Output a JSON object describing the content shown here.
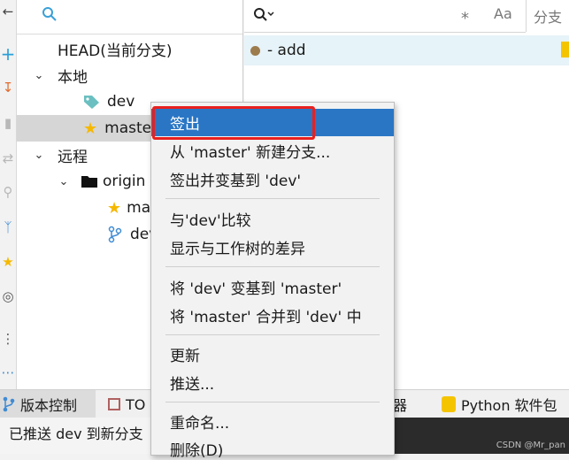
{
  "toolbar_icons": [
    "back-arrow-icon",
    "add-icon",
    "fetch-icon",
    "delete-icon",
    "compare-icon",
    "search-icon",
    "branch-graph-icon",
    "star-icon",
    "target-icon",
    "more-vertical-icon",
    "more-horizontal-icon"
  ],
  "branch_tree": {
    "head": "HEAD(当前分支)",
    "local_label": "本地",
    "local": [
      {
        "name": "dev"
      },
      {
        "name": "master"
      }
    ],
    "remote_label": "远程",
    "remote_root": "origin",
    "remote": [
      {
        "name": "master"
      },
      {
        "name": "dev"
      }
    ]
  },
  "log": {
    "search_placeholder": "",
    "case_toggle": "Aa",
    "branch_col_label": "分支",
    "rows": [
      {
        "message": "- add"
      }
    ]
  },
  "context_menu": {
    "items": [
      {
        "label": "签出",
        "highlighted": true
      },
      {
        "label": "从 'master' 新建分支..."
      },
      {
        "label": "签出并变基到 'dev'"
      },
      {
        "label": "与'dev'比较"
      },
      {
        "label": "显示与工作树的差异"
      },
      {
        "label": "将 'dev' 变基到 'master'"
      },
      {
        "label": "将 'master' 合并到 'dev' 中"
      },
      {
        "label": "更新"
      },
      {
        "label": "推送..."
      },
      {
        "label": "重命名..."
      },
      {
        "label": "删除(D)"
      }
    ]
  },
  "bottom_tabs": [
    {
      "label": "版本控制",
      "icon": "branch-icon"
    },
    {
      "label": "TO",
      "icon": "todo-icon"
    },
    {
      "label": "器",
      "icon": ""
    },
    {
      "label": "Python 软件包",
      "icon": "package-icon"
    }
  ],
  "status": {
    "text": "已推送 dev 到新分支"
  },
  "watermark": "CSDN @Mr_pan",
  "colors": {
    "accent": "#2a76c5",
    "highlight_box": "#e8201e",
    "tag": "#6bbfc0",
    "star": "#f5b800",
    "branch": "#3f8bd4",
    "commit_dot": "#9c7b4d"
  }
}
